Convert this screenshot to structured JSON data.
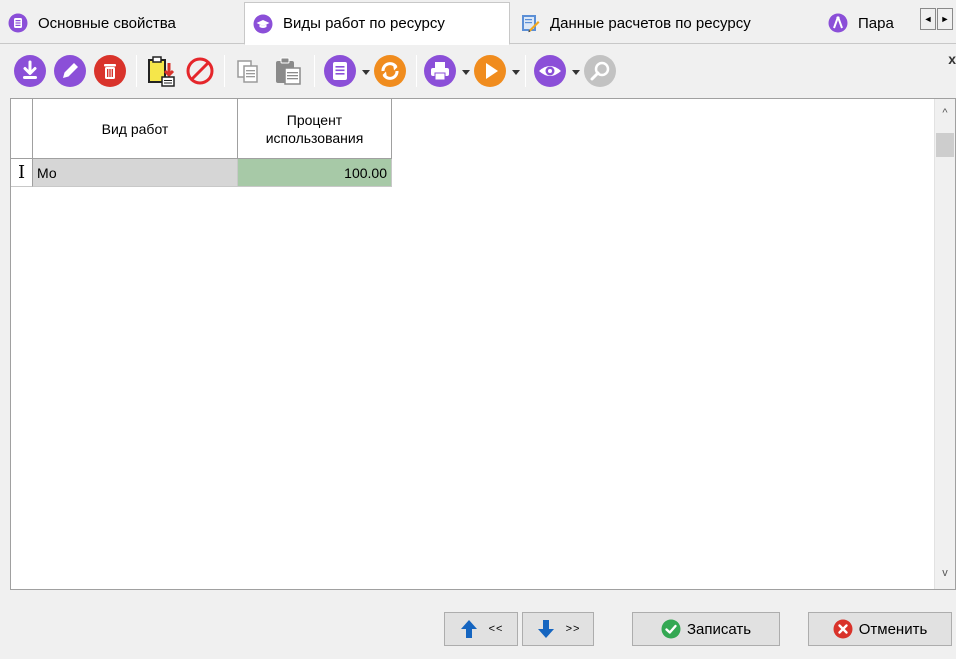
{
  "tabs": [
    {
      "label": "Основные свойства",
      "icon": "list-icon",
      "active": false
    },
    {
      "label": "Виды работ по ресурсу",
      "icon": "graduation-cap-icon",
      "active": true
    },
    {
      "label": "Данные расчетов по ресурсу",
      "icon": "edit-document-icon",
      "active": false
    },
    {
      "label": "Пара",
      "icon": "compass-icon",
      "active": false
    }
  ],
  "tab_scroll": {
    "left": "◄",
    "right": "►"
  },
  "toolbar": {
    "close": "x",
    "buttons": [
      "download-icon",
      "edit-icon",
      "delete-icon",
      "import-icon",
      "cancel-icon",
      "copy-icon",
      "paste-icon",
      "document-icon",
      "refresh-icon",
      "print-icon",
      "play-icon",
      "view-icon",
      "search-icon"
    ]
  },
  "grid": {
    "columns": [
      {
        "label": "Вид работ"
      },
      {
        "label": "Процент использования"
      }
    ],
    "rows": [
      {
        "indicator": "I",
        "name": "Мо",
        "percent": "100.00"
      }
    ]
  },
  "scrollbar": {
    "up": "^",
    "down": "v"
  },
  "bottom": {
    "prev": "<<",
    "next": ">>",
    "save": "Записать",
    "cancel": "Отменить"
  },
  "colors": {
    "purple": "#8b4fd8",
    "red": "#d9332b",
    "orange": "#f08c1e",
    "green": "#34a853",
    "blue": "#1565c0",
    "row_percent_bg": "#a7c9a7"
  }
}
